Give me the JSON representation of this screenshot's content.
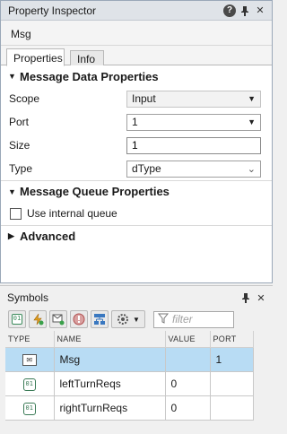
{
  "inspector": {
    "title": "Property Inspector",
    "object_name": "Msg",
    "tabs": [
      {
        "label": "Properties",
        "active": true
      },
      {
        "label": "Info",
        "active": false
      }
    ],
    "sections": {
      "data": "Message Data Properties",
      "queue": "Message Queue Properties",
      "advanced": "Advanced"
    },
    "fields": {
      "scope": {
        "label": "Scope",
        "value": "Input"
      },
      "port": {
        "label": "Port",
        "value": "1"
      },
      "size": {
        "label": "Size",
        "value": "1"
      },
      "type": {
        "label": "Type",
        "value": "dType"
      }
    },
    "queue_checkbox": {
      "label": "Use internal queue",
      "checked": false
    }
  },
  "symbols": {
    "title": "Symbols",
    "filter_placeholder": "filter",
    "columns": [
      "TYPE",
      "NAME",
      "VALUE",
      "PORT"
    ],
    "rows": [
      {
        "icon": "message-icon",
        "name": "Msg",
        "value": "",
        "port": "1",
        "selected": true
      },
      {
        "icon": "data-icon",
        "name": "leftTurnReqs",
        "value": "0",
        "port": "",
        "selected": false
      },
      {
        "icon": "data-icon",
        "name": "rightTurnReqs",
        "value": "0",
        "port": "",
        "selected": false
      }
    ],
    "toolbar_icons": [
      "add-data-icon",
      "add-event-icon",
      "add-message-icon",
      "remove-icon",
      "resolve-icon",
      "settings-dropdown-icon",
      "filter-icon"
    ]
  },
  "colors": {
    "selection": "#b8dcf4",
    "titlebar": "#dfe3e8"
  }
}
